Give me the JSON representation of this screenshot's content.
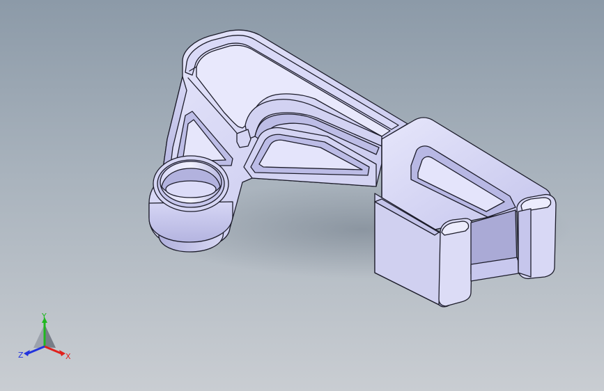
{
  "viewport": {
    "background_top": "#8c9aa8",
    "background_bottom": "#c9cdd2"
  },
  "model": {
    "face_color": "#c9c9ee",
    "face_light": "#e3e3fa",
    "face_shadow": "#9a9ac8",
    "edge_color": "#1c1c2a"
  },
  "triad": {
    "x_label": "X",
    "y_label": "Y",
    "z_label": "Z",
    "x_color": "#e0201c",
    "y_color": "#1fb81f",
    "z_color": "#2233dd"
  }
}
